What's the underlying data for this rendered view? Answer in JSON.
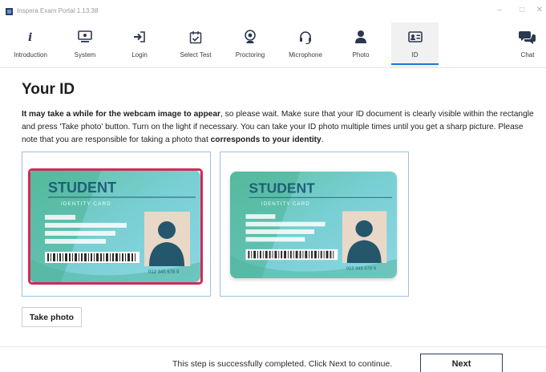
{
  "window": {
    "title": "Inspera Exam Portal 1.13.38"
  },
  "nav": {
    "items": [
      {
        "label": "Introduction",
        "icon": "info-icon"
      },
      {
        "label": "System",
        "icon": "monitor-icon"
      },
      {
        "label": "Login",
        "icon": "login-icon"
      },
      {
        "label": "Select Test",
        "icon": "calendar-check-icon"
      },
      {
        "label": "Proctoring",
        "icon": "webcam-icon"
      },
      {
        "label": "Microphone",
        "icon": "headset-icon"
      },
      {
        "label": "Photo",
        "icon": "person-icon"
      },
      {
        "label": "ID",
        "icon": "id-card-icon",
        "active": true
      }
    ],
    "chat": {
      "label": "Chat",
      "icon": "chat-icon"
    }
  },
  "main": {
    "title": "Your ID",
    "instructions": {
      "bold_intro": "It may take a while for the webcam image to appear",
      "text_1": ", so please wait. Make sure that your ID document is clearly visible within the rectangle and press 'Take photo' button. Turn on the light if necessary. You can take your ID photo multiple times until you get a sharp picture. Please note that you are responsible for taking a photo that ",
      "bold_end": "corresponds to your identity",
      "text_2": "."
    },
    "card": {
      "title": "STUDENT",
      "subtitle": "IDENTITY CARD",
      "number": "012 345 678 9"
    },
    "take_photo_label": "Take photo"
  },
  "footer": {
    "status": "This step is successfully completed. Click Next to continue.",
    "next_label": "Next"
  },
  "colors": {
    "accent": "#1c78d6",
    "highlight": "#d12c58",
    "card_blue": "#7fd0dc",
    "card_green": "#62c0a6",
    "card_title": "#1f5f79"
  }
}
